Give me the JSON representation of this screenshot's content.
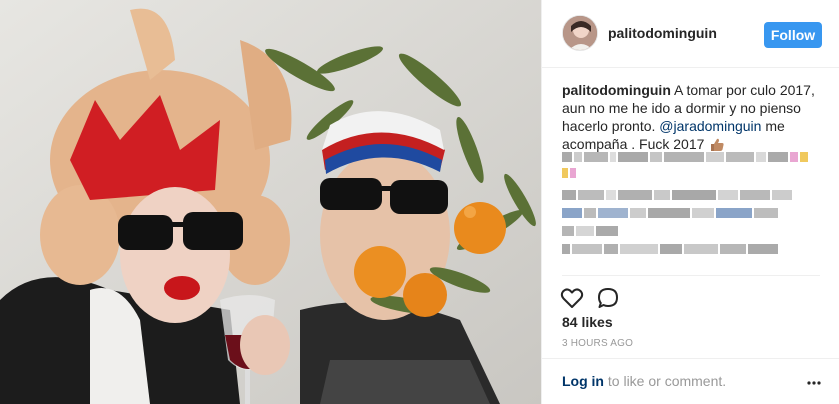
{
  "post": {
    "photo_icon": "photo-image",
    "username": "palitodominguin",
    "follow_label": "Follow",
    "caption": {
      "username": "palitodominguin",
      "text_before": " A tomar por culo 2017, aun no me he ido a dormir y no pienso hacerlo pronto. ",
      "mention": "@jaradominguin",
      "text_after": " me acompaña . Fuck 2017",
      "emoji": "thumbs-up-medium-skin"
    },
    "likes_text": "84 likes",
    "timestamp": "3 HOURS AGO",
    "login_link": "Log in",
    "login_rest": " to like or comment.",
    "icons": {
      "like": "heart-outline-icon",
      "comment": "comment-bubble-icon",
      "more": "more-dots-icon"
    }
  },
  "colors": {
    "follow_bg": "#3897f0",
    "mention": "#003569",
    "muted": "#999999"
  }
}
